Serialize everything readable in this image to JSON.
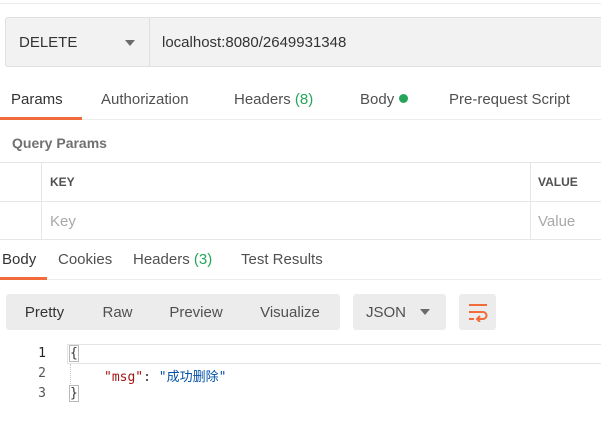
{
  "request": {
    "method": "DELETE",
    "url": "localhost:8080/2649931348"
  },
  "request_tabs": {
    "params": "Params",
    "authorization": "Authorization",
    "headers": "Headers",
    "headers_count": "(8)",
    "body": "Body",
    "prerequest": "Pre-request Script"
  },
  "query_params": {
    "title": "Query Params",
    "columns": {
      "key": "KEY",
      "value": "VALUE"
    },
    "placeholder": {
      "key": "Key",
      "value": "Value"
    }
  },
  "response_tabs": {
    "body": "Body",
    "cookies": "Cookies",
    "headers": "Headers",
    "headers_count": "(3)",
    "test_results": "Test Results"
  },
  "toolbar": {
    "views": [
      "Pretty",
      "Raw",
      "Preview",
      "Visualize"
    ],
    "format": "JSON",
    "wrap_icon": "wrap-lines-icon"
  },
  "response_body": {
    "line_numbers": [
      "1",
      "2",
      "3"
    ],
    "open_brace": "{",
    "key": "\"msg\"",
    "colon": ": ",
    "value": "\"成功删除\"",
    "close_brace": "}"
  },
  "colors": {
    "accent": "#f26b3a",
    "count_green": "#26a55a",
    "json_key": "#a31515",
    "json_string": "#0451a5"
  }
}
